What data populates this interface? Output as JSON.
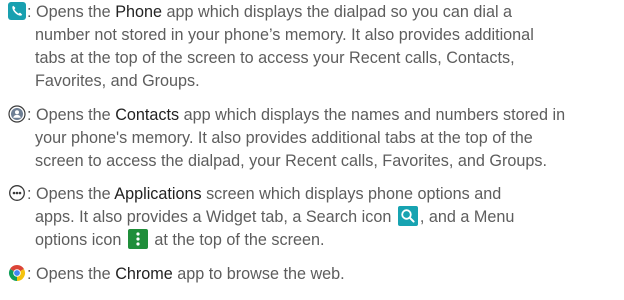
{
  "entries": [
    {
      "icon": "phone-icon",
      "app_name": "Phone",
      "lines": [
        [
          ": Opens the ",
          "Phone",
          " app which displays the dialpad so you can dial a"
        ],
        [
          "number not stored in your phone’s memory. It also provides additional"
        ],
        [
          "tabs at the top of the screen to access your Recent calls, Contacts,"
        ],
        [
          "Favorites, and Groups."
        ]
      ]
    },
    {
      "icon": "contacts-icon",
      "app_name": "Contacts",
      "lines": [
        [
          ": Opens the ",
          "Contacts",
          " app which displays the names and numbers stored in"
        ],
        [
          "your phone's memory. It also provides additional tabs at the top of the"
        ],
        [
          "screen to access the dialpad, your Recent calls, Favorites, and Groups."
        ]
      ]
    },
    {
      "icon": "apps-icon",
      "app_name": "Applications",
      "lines": [
        [
          ": Opens the ",
          "Applications",
          " screen which displays phone options and"
        ],
        [
          "apps. It also provides a Widget tab, a Search icon ",
          ", and a Menu"
        ],
        [
          "options icon ",
          " at the top of the screen."
        ]
      ]
    },
    {
      "icon": "chrome-icon",
      "app_name": "Chrome",
      "lines": [
        [
          ": Opens the ",
          "Chrome",
          " app to browse the web."
        ]
      ]
    }
  ],
  "colors": {
    "text": "#5d5d5d",
    "bold_text": "#222222",
    "phone_icon_bg": "#19a0b0",
    "search_icon_bg": "#17a3b1",
    "menu_icon_bg": "#1f8e3a"
  }
}
